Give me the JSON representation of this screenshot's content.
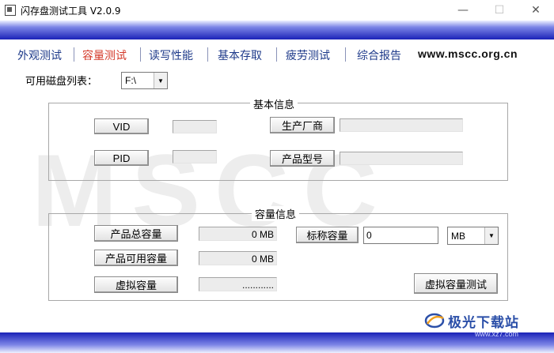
{
  "window": {
    "title": "闪存盘测试工具  V2.0.9",
    "minimize": "—",
    "maximize": "☐",
    "close": "✕"
  },
  "nav": {
    "items": [
      {
        "label": "外观测试"
      },
      {
        "label": "容量测试",
        "active": true
      },
      {
        "label": "读写性能"
      },
      {
        "label": "基本存取"
      },
      {
        "label": "疲劳测试"
      },
      {
        "label": "综合报告"
      }
    ],
    "site": "www.mscc.org.cn",
    "active_color": "#d43a2a",
    "item_color": "#1e3a8a"
  },
  "disk": {
    "label": "可用磁盘列表：",
    "selected": "F:\\"
  },
  "watermark": "MSCC",
  "basic_info": {
    "title": "基本信息",
    "vid_button": "VID",
    "vid_value": "",
    "pid_button": "PID",
    "pid_value": "",
    "manufacturer_button": "生产厂商",
    "manufacturer_value": "",
    "model_button": "产品型号",
    "model_value": ""
  },
  "capacity_info": {
    "title": "容量信息",
    "total_button": "产品总容量",
    "total_value": "0 MB",
    "available_button": "产品可用容量",
    "available_value": "0 MB",
    "virtual_button": "虚拟容量",
    "virtual_value": "............",
    "nominal_button": "标称容量",
    "nominal_value": "0",
    "unit_selected": "MB",
    "virtual_test_button": "虚拟容量测试"
  },
  "logo": {
    "text": "极光下载站",
    "url": "www.xz7.com",
    "icon": "aurora-logo-icon"
  },
  "colors": {
    "band_dark": "#1a22b8",
    "band_light": "#eef1ff"
  }
}
